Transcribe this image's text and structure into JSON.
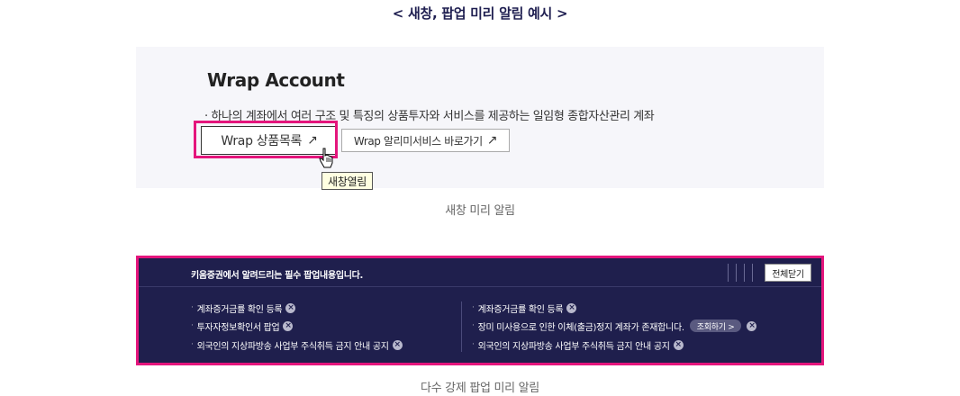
{
  "heading": "< 새창, 팝업 미리 알림 예시 >",
  "example1": {
    "title": "Wrap Account",
    "description": "· 하나의 계좌에서 여러 구조 및 특징의 상품투자와 서비스를 제공하는 일임형 종합자산관리 계좌",
    "primary_button": "Wrap 상품목록",
    "secondary_button": "Wrap 알리미서비스 바로가기",
    "arrow_glyph": "↗",
    "tooltip": "새창열림",
    "caption": "새창 미리 알림"
  },
  "example2": {
    "popup_title": "키움증권에서 알려드리는 필수 팝업내용입니다.",
    "close_all": "전체닫기",
    "left_items": [
      {
        "label": "계좌증거금률 확인 등록"
      },
      {
        "label": "투자자정보확인서 팝업"
      },
      {
        "label": "외국인의 지상파방송 사업부 주식취득 금지 안내 공지"
      }
    ],
    "right_items": [
      {
        "label": "계좌증거금률 확인 등록"
      },
      {
        "label": "장미 미사용으로 인한 이체(출금)정지 계좌가 존재합니다.",
        "button": "조회하기 >"
      },
      {
        "label": "외국인의 지상파방송 사업부 주식취득 금지 안내 공지"
      }
    ],
    "close_glyph": "×",
    "bullet": "·",
    "caption": "다수 강제 팝업 미리 알림"
  },
  "colors": {
    "highlight": "#e4157c",
    "popup_bg": "#1f1f4d",
    "heading": "#1e1e50",
    "tooltip_bg": "#ffffe1"
  }
}
